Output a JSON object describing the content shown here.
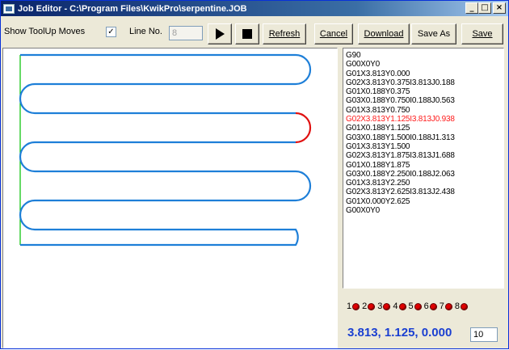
{
  "window": {
    "title": "Job Editor - C:\\Program Files\\KwikPro\\serpentine.JOB",
    "controls": [
      "_",
      "□",
      "×"
    ]
  },
  "toolbar": {
    "show_toolup_label": "Show ToolUp Moves",
    "show_toolup_checked": "✓",
    "line_no_label": "Line No.",
    "line_no_value": "8",
    "play_icon": "play-icon",
    "stop_icon": "stop-icon",
    "refresh_label": "Refresh",
    "cancel_label": "Cancel",
    "download_label": "Download",
    "save_as_label": "Save As",
    "save_label": "Save"
  },
  "gcode": {
    "lines": [
      "G90",
      "G00X0Y0",
      "G01X3.813Y0.000",
      "G02X3.813Y0.375I3.813J0.188",
      "G01X0.188Y0.375",
      "G03X0.188Y0.750I0.188J0.563",
      "G01X3.813Y0.750",
      "G02X3.813Y1.125I3.813J0.938",
      "G01X0.188Y1.125",
      "G03X0.188Y1.500I0.188J1.313",
      "G01X3.813Y1.500",
      "G02X3.813Y1.875I3.813J1.688",
      "G01X0.188Y1.875",
      "G03X0.188Y2.250I0.188J2.063",
      "G01X3.813Y2.250",
      "G02X3.813Y2.625I3.813J2.438",
      "G01X0.000Y2.625",
      "G00X0Y0"
    ],
    "active_index": 7
  },
  "status": {
    "leds": [
      "1",
      "2",
      "3",
      "4",
      "5",
      "6",
      "7",
      "8"
    ],
    "led_color": "#e00000",
    "coords": "3.813, 1.125, 0.000",
    "step_value": "10"
  },
  "colors": {
    "toolpath": "#1e7fd8",
    "active_segment": "#e01010",
    "toolup": "#00c000",
    "coords_text": "#1a3fd1"
  }
}
